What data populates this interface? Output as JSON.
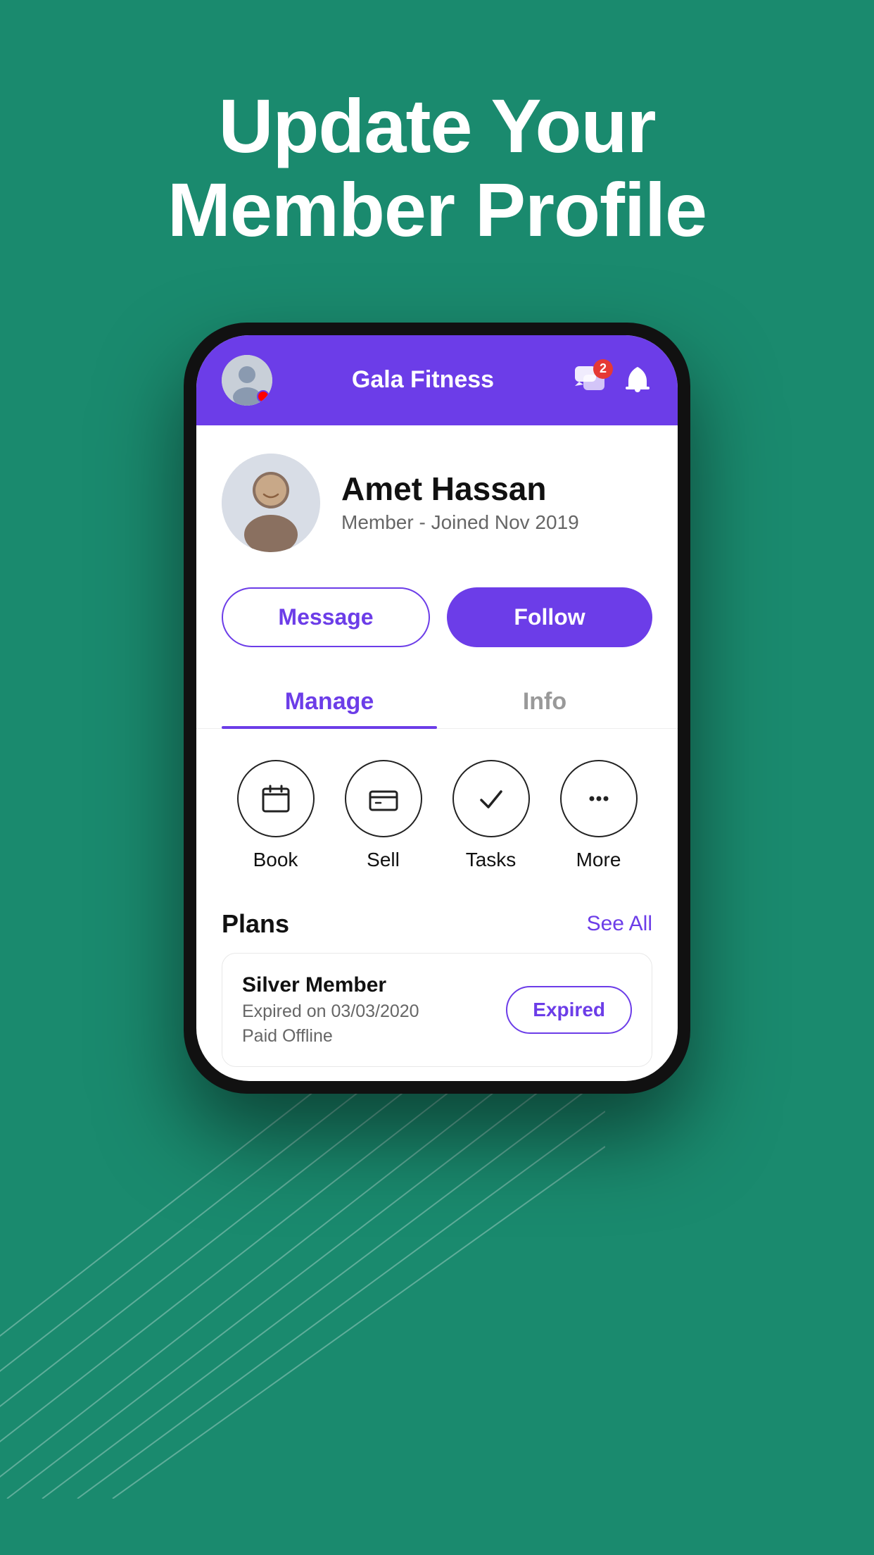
{
  "hero": {
    "title_line1": "Update Your",
    "title_line2": "Member Profile"
  },
  "app": {
    "name": "Gala Fitness",
    "chat_badge": "2"
  },
  "profile": {
    "name": "Amet Hassan",
    "subtitle": "Member - Joined Nov 2019"
  },
  "buttons": {
    "message": "Message",
    "follow": "Follow"
  },
  "tabs": [
    {
      "label": "Manage",
      "active": true
    },
    {
      "label": "Info",
      "active": false
    }
  ],
  "quick_actions": [
    {
      "label": "Book",
      "icon": "📅"
    },
    {
      "label": "Sell",
      "icon": "💳"
    },
    {
      "label": "Tasks",
      "icon": "✓"
    },
    {
      "label": "More",
      "icon": "···"
    }
  ],
  "plans": {
    "section_title": "Plans",
    "see_all": "See All",
    "items": [
      {
        "name": "Silver Member",
        "detail1": "Expired on 03/03/2020",
        "detail2": "Paid Offline",
        "status": "Expired"
      }
    ]
  }
}
